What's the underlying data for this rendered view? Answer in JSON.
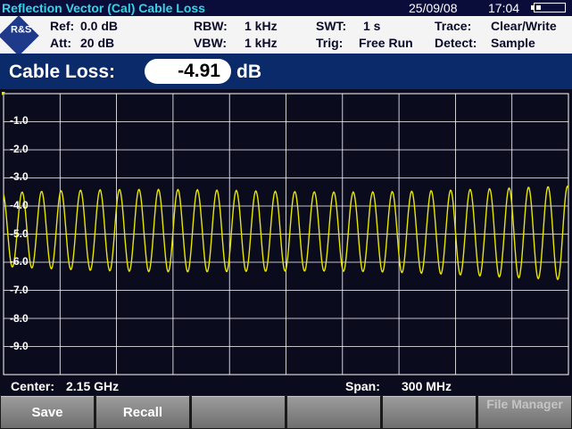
{
  "titlebar": {
    "title": "Reflection Vector (Cal) Cable Loss",
    "date": "25/09/08",
    "time": "17:04"
  },
  "params": {
    "ref": {
      "label": "Ref:",
      "value": "0.0 dB"
    },
    "att": {
      "label": "Att:",
      "value": "20 dB"
    },
    "rbw": {
      "label": "RBW:",
      "value": "1 kHz"
    },
    "vbw": {
      "label": "VBW:",
      "value": "1 kHz"
    },
    "swt": {
      "label": "SWT:",
      "value": "1 s"
    },
    "trig": {
      "label": "Trig:",
      "value": "Free Run"
    },
    "trace": {
      "label": "Trace:",
      "value": "Clear/Write"
    },
    "detect": {
      "label": "Detect:",
      "value": "Sample"
    }
  },
  "logo_text": "R&S",
  "cable_loss": {
    "label": "Cable Loss:",
    "value": "-4.91",
    "unit": "dB"
  },
  "y_axis_labels": [
    "-1.0",
    "-2.0",
    "-3.0",
    "-4.0",
    "-5.0",
    "-6.0",
    "-7.0",
    "-8.0",
    "-9.0"
  ],
  "status": {
    "center_label": "Center:",
    "center_value": "2.15 GHz",
    "span_label": "Span:",
    "span_value": "300 MHz"
  },
  "softkeys": [
    {
      "label": "Save",
      "enabled": true
    },
    {
      "label": "Recall",
      "enabled": true
    },
    {
      "label": "",
      "enabled": true
    },
    {
      "label": "",
      "enabled": true
    },
    {
      "label": "",
      "enabled": true
    },
    {
      "label": "File Manager",
      "enabled": false
    }
  ],
  "colors": {
    "trace": "#e6e600",
    "grid": "#ffffff",
    "header": "#0b2a6a",
    "title_text": "#36d3e6"
  },
  "chart_data": {
    "type": "line",
    "ylim": [
      -10.0,
      0.0
    ],
    "x_center_ghz": 2.15,
    "x_span_mhz": 300,
    "grid": true,
    "series": [
      {
        "approx_min_db": -6.5,
        "approx_max_db": -3.3,
        "mean_db": -4.91,
        "cycles": 29
      }
    ]
  }
}
